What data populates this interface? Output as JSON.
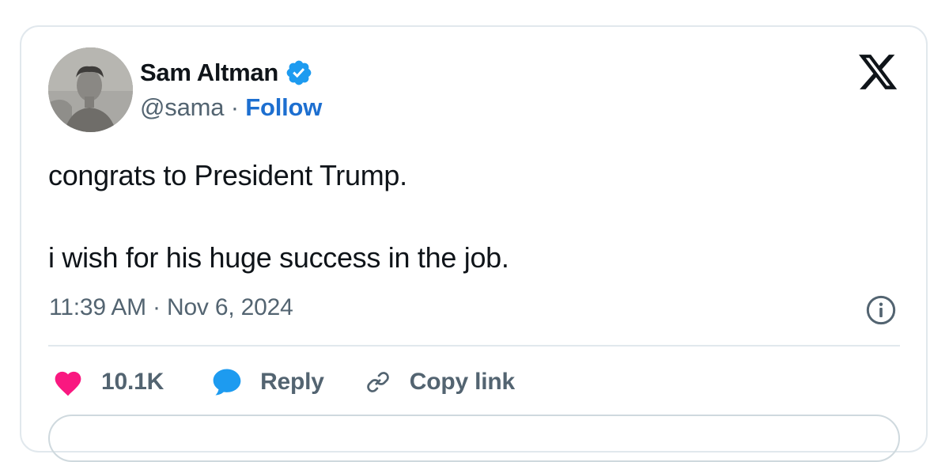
{
  "author": {
    "name": "Sam Altman",
    "handle": "@sama",
    "separator": " · ",
    "follow_label": "Follow",
    "verified": true
  },
  "tweet": {
    "line1": "congrats to President Trump.",
    "line2": "i wish for his huge success in the job.",
    "timestamp": "11:39 AM · Nov 6, 2024"
  },
  "actions": {
    "likes": "10.1K",
    "reply_label": "Reply",
    "copy_link_label": "Copy link"
  },
  "colors": {
    "like": "#f91880",
    "reply": "#1d9bf0",
    "follow": "#1d6fd0",
    "verified": "#1d9bf0",
    "secondary_text": "#536471",
    "primary_text": "#0f1419"
  },
  "icons": {
    "platform": "x-logo-icon",
    "verified": "verified-badge-icon",
    "info": "info-icon",
    "like": "heart-icon",
    "reply": "speech-bubble-icon",
    "copy": "link-icon"
  }
}
